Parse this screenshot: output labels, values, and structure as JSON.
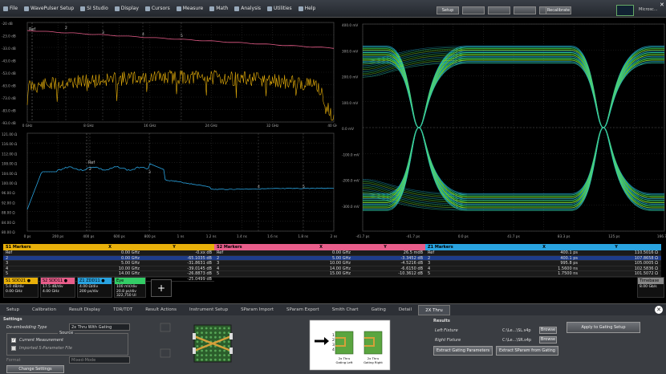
{
  "menu": [
    {
      "label": "File",
      "icon": "file-icon"
    },
    {
      "label": "WavePulser Setup",
      "icon": "waveform-icon"
    },
    {
      "label": "SI Studio",
      "icon": "studio-icon"
    },
    {
      "label": "Display",
      "icon": "display-icon"
    },
    {
      "label": "Cursors",
      "icon": "cursor-icon"
    },
    {
      "label": "Measure",
      "icon": "measure-icon"
    },
    {
      "label": "Math",
      "icon": "math-icon"
    },
    {
      "label": "Analysis",
      "icon": "analysis-icon"
    },
    {
      "label": "Utilities",
      "icon": "wrench-icon"
    },
    {
      "label": "Help",
      "icon": "help-icon"
    }
  ],
  "toolbar": {
    "setup": "Setup",
    "b2": "",
    "b3": "",
    "b4": "",
    "b5": "",
    "recalibrate": "Recalibrate",
    "logo": "Microsc..."
  },
  "plot1": {
    "ylabels": [
      "-20 dB",
      "-23.0 dB",
      "-33.0 dB",
      "-43.0 dB",
      "-53.0 dB",
      "-63.0 dB",
      "-73.0 dB",
      "-83.0 dB",
      "-93.0 dB"
    ],
    "xlabels": [
      "0 GHz",
      "8 GHz",
      "16 GHz",
      "24 GHz",
      "32 GHz",
      "40 GHz"
    ],
    "ref": "Ref",
    "markers": [
      "2",
      "3",
      "4",
      "5"
    ]
  },
  "plot2": {
    "ylabels": [
      "121.00 Ω",
      "116.00 Ω",
      "112.00 Ω",
      "108.00 Ω",
      "104.00 Ω",
      "100.00 Ω",
      "96.00 Ω",
      "92.00 Ω",
      "88.00 Ω",
      "84.00 Ω",
      "80.00 Ω"
    ],
    "xlabels": [
      "0 ps",
      "200 ps",
      "400 ps",
      "600 ps",
      "800 ps",
      "1 ns",
      "1.2 ns",
      "1.4 ns",
      "1.6 ns",
      "1.8 ns",
      "2 ns"
    ],
    "ref": "Ref",
    "markers": [
      "2",
      "3",
      "4",
      "5"
    ]
  },
  "eye": {
    "ylabels": [
      "400.0 mV",
      "300.0 mV",
      "200.0 mV",
      "100.0 mV",
      "0.0 mV",
      "-100.0 mV",
      "-200.0 mV",
      "-300.0 mV"
    ],
    "xlabels": [
      "-41.7 ps",
      "-41.7 ps",
      "0.0 ps",
      "41.7 ps",
      "83.3 ps",
      "125 ps",
      "166.7 ps"
    ]
  },
  "table1": {
    "title": "S1 Markers",
    "col_x": "X",
    "col_y": "Y",
    "rows": [
      {
        "id": "Ref",
        "x": "0.00 GHz",
        "y": "-0.xx dB"
      },
      {
        "id": "2",
        "x": "0.00 GHz",
        "y": "-65.1035 dB"
      },
      {
        "id": "3",
        "x": "5.00 GHz",
        "y": "-31.8631 dB"
      },
      {
        "id": "4",
        "x": "10.00 GHz",
        "y": "-39.0145 dB"
      },
      {
        "id": "5",
        "x": "14.00 GHz",
        "y": "-26.8873 dB"
      },
      {
        "id": "6",
        "x": "15.00 GHz",
        "y": "-25.0499 dB"
      }
    ]
  },
  "table2": {
    "title": "S2 Markers",
    "col_x": "X",
    "col_y": "Y",
    "rows": [
      {
        "id": "Ref",
        "x": "0.00 GHz",
        "y": "26.5 mdB"
      },
      {
        "id": "2",
        "x": "5.00 GHz",
        "y": "-3.3452 dB"
      },
      {
        "id": "3",
        "x": "10.00 GHz",
        "y": "-4.5216 dB"
      },
      {
        "id": "4",
        "x": "14.00 GHz",
        "y": "-6.6150 dB"
      },
      {
        "id": "5",
        "x": "15.00 GHz",
        "y": "-10.3612 dB"
      }
    ]
  },
  "table3": {
    "title": "Z1 Markers",
    "col_x": "X",
    "col_y": "Y",
    "rows": [
      {
        "id": "Ref",
        "x": "400.1 ps",
        "y": "110.5016 Ω"
      },
      {
        "id": "2",
        "x": "400.1 ps",
        "y": "107.8658 Ω"
      },
      {
        "id": "3",
        "x": "995.8 ps",
        "y": "105.0005 Ω"
      },
      {
        "id": "4",
        "x": "1.5600 ns",
        "y": "102.5836 Ω"
      },
      {
        "id": "5",
        "x": "1.7500 ns",
        "y": "101.5072 Ω"
      }
    ]
  },
  "traces": [
    {
      "head": "S1 SDD21 ●",
      "line1": "5.0 dB/div",
      "line2": "0.00 GHz",
      "color": "#e8b00a"
    },
    {
      "head": "S2 SDD11 ●",
      "line1": "17.5 dB/div",
      "line2": "4.00 GHz",
      "color": "#e85d8a"
    },
    {
      "head": "Z1 ZDD11 ●",
      "line1": "4.00 Ω/div",
      "line2": "200 ps/div",
      "color": "#29a3e0"
    },
    {
      "head": "Eye",
      "line1": "100 mV/div",
      "line2": "20.8 ps/div",
      "line3": "322,750 UI",
      "color": "#33cc66"
    }
  ],
  "timebase": {
    "head": "Timebase",
    "line1": "8.00 Gb/s"
  },
  "tabs": [
    "Setup",
    "Calibration",
    "Result Display",
    "TDR/TDT",
    "Result Actions",
    "Instrument Setup",
    "SParam Import",
    "SParam Export",
    "Smith Chart",
    "Gating",
    "Detail",
    "2X Thru"
  ],
  "settings": {
    "title": "Settings",
    "deembedding_label": "De-embedding Type",
    "deembedding_value": "2x Thru With Gating",
    "source_label": "Source",
    "current_measurement": "Current Measurement",
    "imported_sparam": "Imported S-Parameter File",
    "format_label": "Format",
    "format_value": "Mixed-Mode",
    "change_settings": "Change Settings"
  },
  "diagram": {
    "port1": "P1",
    "port2": "P2",
    "port3": "P3",
    "port4": "P4",
    "gating_left": "2x Thru",
    "gating_right": "2x Thru",
    "sub_left": "Gating Left",
    "sub_right": "Gating Right",
    "nums": [
      "1",
      "2",
      "3",
      "4"
    ]
  },
  "results": {
    "title": "Results",
    "left_fixture": "Left Fixture",
    "left_value": "C:\\Le...\\SL.s4p",
    "right_fixture": "Right Fixture",
    "right_value": "C:\\Le...\\SR.s4p",
    "browse": "Browse",
    "extract_gating": "Extract Gating Parameters",
    "extract_sparam": "Extract SParam from Gating",
    "apply": "Apply to Gating Setup"
  },
  "colors": {
    "s1": "#e8b00a",
    "s2": "#e85d8a",
    "z1": "#29a3e0",
    "eye_outer": "#1ea0c8",
    "eye_inner": "#44dd44"
  }
}
